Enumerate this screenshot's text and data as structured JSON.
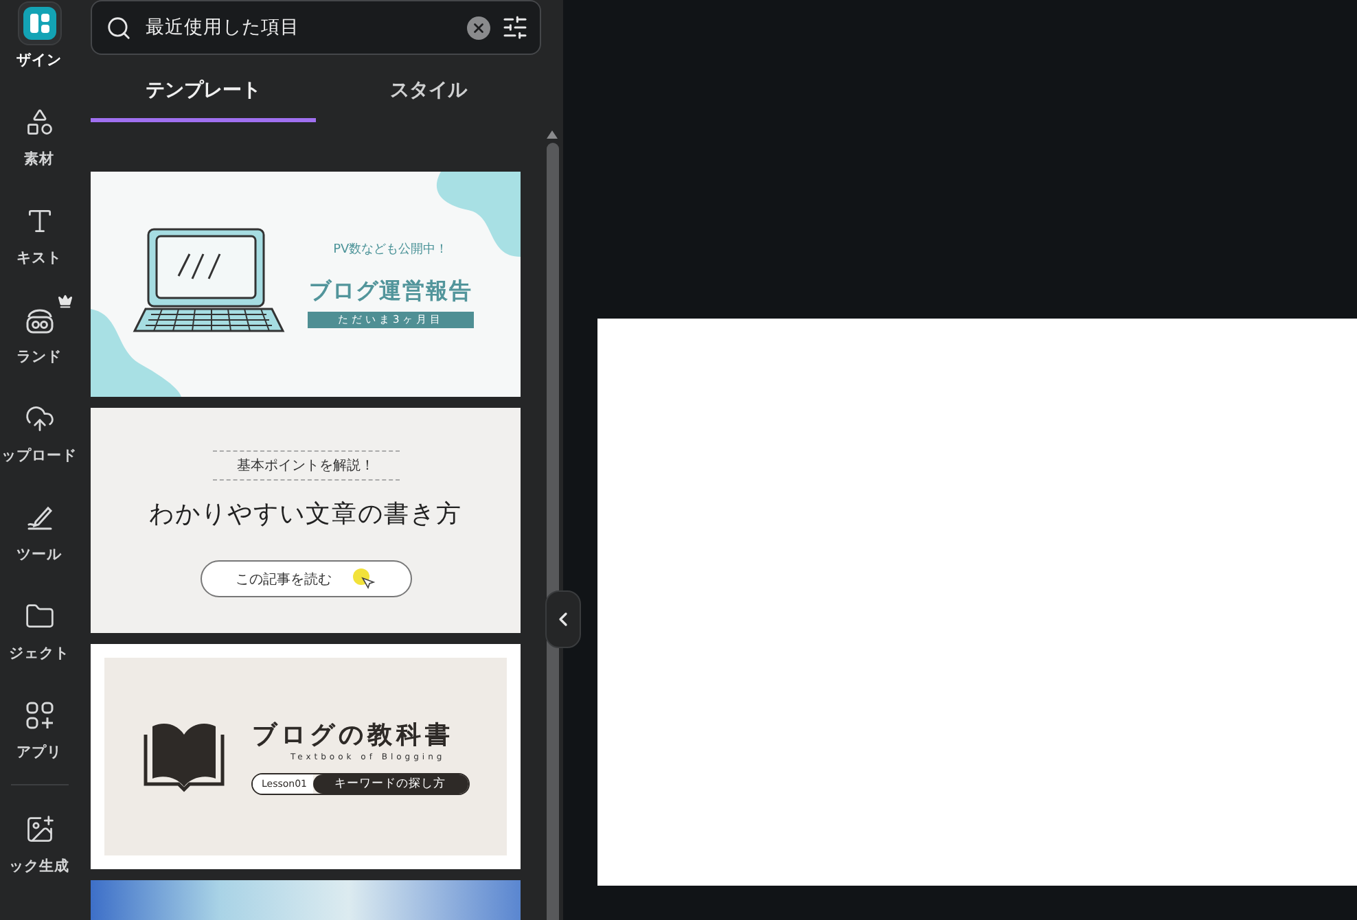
{
  "rail": {
    "items": [
      {
        "label": "ザイン",
        "selected": true,
        "premium": false
      },
      {
        "label": "素材",
        "selected": false,
        "premium": false
      },
      {
        "label": "キスト",
        "selected": false,
        "premium": false
      },
      {
        "label": "ランド",
        "selected": false,
        "premium": true
      },
      {
        "label": "ップロード",
        "selected": false,
        "premium": false
      },
      {
        "label": "ツール",
        "selected": false,
        "premium": false
      },
      {
        "label": "ジェクト",
        "selected": false,
        "premium": false
      },
      {
        "label": "アプリ",
        "selected": false,
        "premium": false
      },
      {
        "label": "ック生成",
        "selected": false,
        "premium": false
      }
    ]
  },
  "search": {
    "value": "最近使用した項目"
  },
  "tabs": [
    {
      "label": "テンプレート",
      "selected": true
    },
    {
      "label": "スタイル",
      "selected": false
    }
  ],
  "templates": [
    {
      "kind": "report",
      "bubble": "PV数なども公開中！",
      "title": "ブログ運営報告",
      "band": "ただいま3ヶ月目"
    },
    {
      "kind": "guide",
      "eyebrow": "基本ポイントを解説！",
      "title": "わかりやすい文章の書き方",
      "cta": "この記事を読む"
    },
    {
      "kind": "textbook",
      "title": "ブログの教科書",
      "subtitle": "Textbook of Blogging",
      "lesson": "Lesson01",
      "topic": "キーワードの探し方"
    },
    {
      "kind": "photo"
    }
  ]
}
